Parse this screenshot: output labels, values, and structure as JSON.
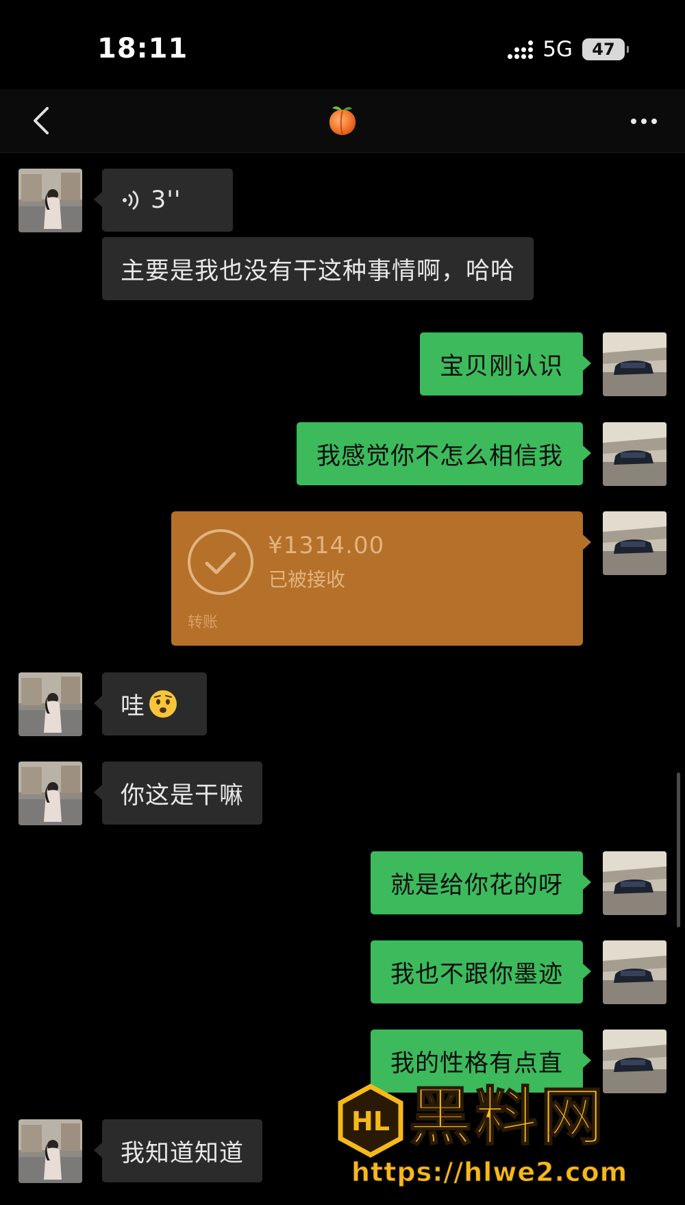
{
  "status_bar": {
    "time": "18:11",
    "network": "5G",
    "battery": "47"
  },
  "nav": {
    "title_icon": "peach-emoji",
    "back_icon": "chevron-left-icon",
    "more_icon": "more-dots-icon"
  },
  "messages": [
    {
      "side": "in",
      "type": "voice",
      "duration": "3''"
    },
    {
      "side": "in",
      "type": "text",
      "text": "主要是我也没有干这种事情啊，哈哈"
    },
    {
      "side": "out",
      "type": "text",
      "text": "宝贝刚认识"
    },
    {
      "side": "out",
      "type": "text",
      "text": "我感觉你不怎么相信我"
    },
    {
      "side": "out",
      "type": "transfer",
      "amount": "¥1314.00",
      "status": "已被接收",
      "label": "转账"
    },
    {
      "side": "in",
      "type": "text",
      "text": "哇",
      "emoji": "worried-face-emoji"
    },
    {
      "side": "in",
      "type": "text",
      "text": "你这是干嘛"
    },
    {
      "side": "out",
      "type": "text",
      "text": "就是给你花的呀"
    },
    {
      "side": "out",
      "type": "text",
      "text": "我也不跟你墨迹"
    },
    {
      "side": "out",
      "type": "text",
      "text": "我的性格有点直"
    },
    {
      "side": "in",
      "type": "text",
      "text": "我知道知道"
    }
  ],
  "watermark": {
    "logo_letters": "HL",
    "brand": "黑料网",
    "url": "https://hlwe2.com"
  },
  "colors": {
    "background": "#000000",
    "incoming_bubble": "#2b2b2b",
    "outgoing_bubble": "#3cba5c",
    "transfer_card": "#b5702a",
    "watermark": "#f6b91a"
  }
}
